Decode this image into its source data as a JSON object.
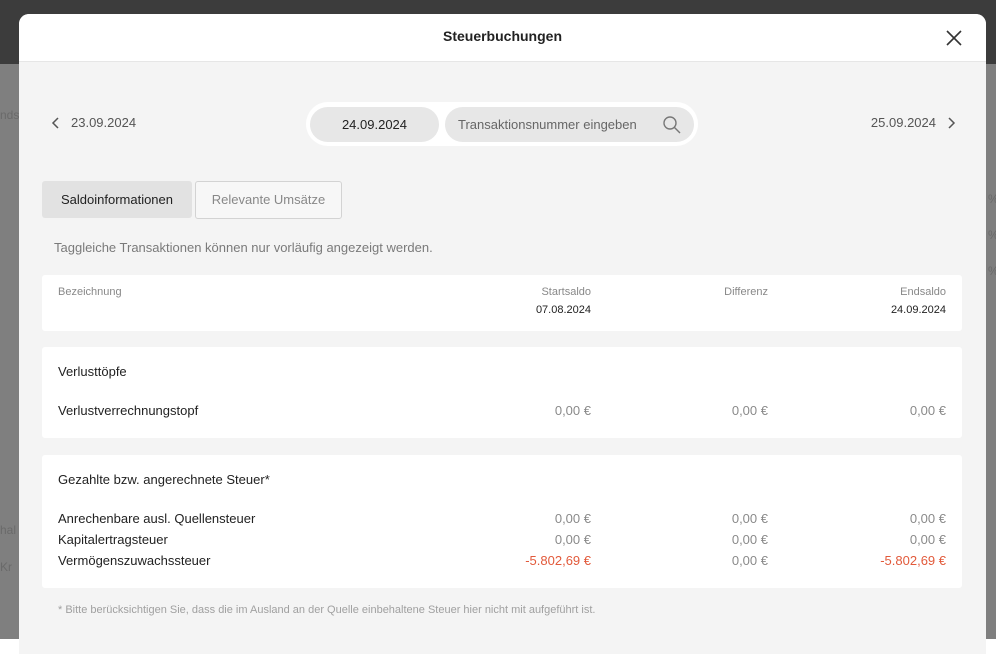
{
  "background": {
    "fragments": [
      "nds",
      "hal",
      "Kr",
      "%",
      "%",
      "%"
    ]
  },
  "modal": {
    "title": "Steuerbuchungen"
  },
  "date_nav": {
    "prev_date": "23.09.2024",
    "current_date": "24.09.2024",
    "next_date": "25.09.2024",
    "search_placeholder": "Transaktionsnummer eingeben"
  },
  "tabs": [
    {
      "label": "Saldoinformationen",
      "active": true
    },
    {
      "label": "Relevante Umsätze",
      "active": false
    }
  ],
  "notice": "Taggleiche Transaktionen können nur vorläufig angezeigt werden.",
  "table_header": {
    "col_name": "Bezeichnung",
    "col_start": "Startsaldo",
    "col_start_date": "07.08.2024",
    "col_diff": "Differenz",
    "col_end": "Endsaldo",
    "col_end_date": "24.09.2024"
  },
  "loss_section": {
    "title": "Verlusttöpfe",
    "rows": [
      {
        "label": "Verlustverrechnungstopf",
        "start": "0,00 €",
        "diff": "0,00 €",
        "end": "0,00 €"
      }
    ]
  },
  "tax_section": {
    "title": "Gezahlte bzw. angerechnete Steuer*",
    "rows": [
      {
        "label": "Anrechenbare ausl. Quellensteuer",
        "start": "0,00 €",
        "diff": "0,00 €",
        "end": "0,00 €"
      },
      {
        "label": "Kapitalertragsteuer",
        "start": "0,00 €",
        "diff": "0,00 €",
        "end": "0,00 €"
      },
      {
        "label": "Vermögenszuwachssteuer",
        "start": "-5.802,69 €",
        "diff": "0,00 €",
        "end": "-5.802,69 €"
      }
    ]
  },
  "footnote": "* Bitte berücksichtigen Sie, dass die im Ausland an der Quelle einbehaltene Steuer hier nicht mit aufgeführt ist.",
  "colors": {
    "negative": "#e25a3b",
    "muted": "#8a8a8a",
    "modal_bg": "#f4f4f4"
  }
}
